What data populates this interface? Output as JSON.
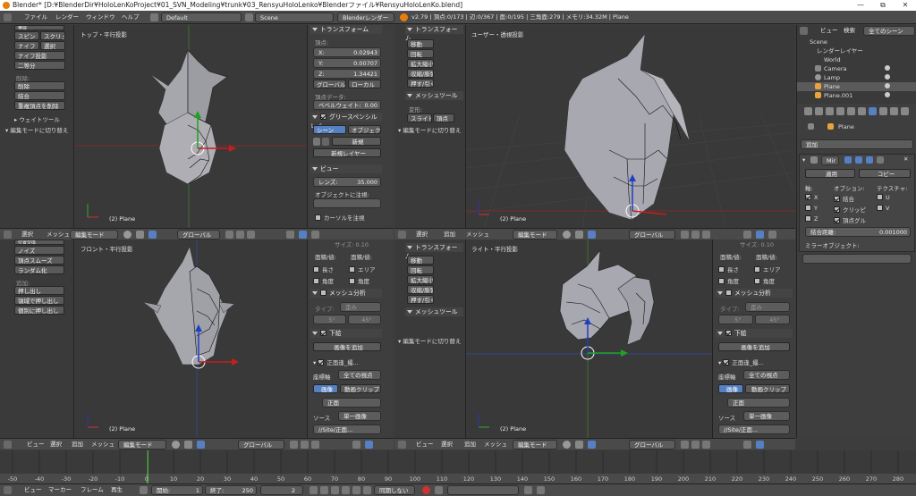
{
  "window": {
    "title": "Blender* [D:¥BlenderDir¥HoloLenKoProject¥01_SVN_Modeling¥trunk¥03_RensyuHoloLenko¥Blenderファイル¥RensyuHoloLenKo.blend]",
    "minimize": "—",
    "maximize": "⧉",
    "close": "✕"
  },
  "infobar": {
    "menu": [
      "ファイル",
      "レンダー",
      "ウィンドウ",
      "ヘルプ"
    ],
    "layout": "Default",
    "scene": "Scene",
    "engine": "Blenderレンダー",
    "stats": "v2.79 | 頂点:0/173 | 辺:0/367 | 面:0/195 | 三角面:279 | メモリ:34.32M | Plane"
  },
  "tool_tl": {
    "header": "権威",
    "row1": [
      "スピン",
      "スクリュー"
    ],
    "row2": [
      "ナイフ",
      "選択"
    ],
    "knife_proj": "ナイフ投影",
    "bisect": "二等分",
    "remove_label": "削除:",
    "delete": "削除",
    "join": "結合",
    "remove_doubles": "重複頂点を削除",
    "weight_tools": "ウェイトツール",
    "edit_mode_toggle": "編集モードに切り替え"
  },
  "tool_bl": {
    "buttons": [
      "位置交換",
      "ノイズ",
      "頂点スムーズ",
      "ランダム化"
    ],
    "add_label": "追加:",
    "extrude": "押し出し",
    "extrude_region": "領域で押し出し",
    "extrude_ind": "個別に押し出し"
  },
  "viewports": {
    "top_label": "トップ・平行投影",
    "user_label": "ユーザー・透視投影",
    "front_label": "フロント・平行投影",
    "right_label": "ライト・平行投影",
    "object": "(2) Plane"
  },
  "header": {
    "view": "ビュー",
    "select": "選択",
    "add": "追加",
    "mesh": "メッシュ",
    "mode": "編集モード",
    "orientation": "グローバル"
  },
  "npanel_tl": {
    "transform": "トランスフォーム",
    "vertex": "頂点:",
    "x": "X:",
    "xv": "0.02943",
    "y": "Y:",
    "yv": "0.00707",
    "z": "Z:",
    "zv": "1.34421",
    "global": "グローバル",
    "local": "ローカル",
    "vertex_data": "頂点データ:",
    "bevel_weight": "ベベルウェイト:",
    "bevel_value": "0.00",
    "gp_layers": "グリースペンシルレイ",
    "scene": "シーン",
    "object_btn": "オブジェクト",
    "new": "新規",
    "new_layer": "新規レイヤー",
    "view": "ビュー",
    "lens": "レンズ:",
    "lens_value": "35.000",
    "lock_to_obj": "オブジェクトに注視:",
    "lock_cursor": "カーソルを注視"
  },
  "tool_tr": {
    "transform": "トランスフォーム",
    "buttons": [
      "移動",
      "回転",
      "拡大縮小",
      "収縮/膨張",
      "押す/引く"
    ],
    "mesh_tools": "メッシュツール",
    "deform": "変形:",
    "slide": "スライド",
    "vertex": "頂点",
    "edit_mode_toggle": "編集モードに切り替え"
  },
  "npanel_bl": {
    "size": "サイズ: 0.10",
    "face_area_label": "面積/値:",
    "edge_length": "長さ",
    "area": "エリア",
    "angle": "角度",
    "face_angle": "角度",
    "mesh_analysis": "メッシュ分析",
    "type": "タイプ:",
    "type_value": "歪み",
    "min": "5°",
    "max": "45°",
    "background": "下絵",
    "add_image": "画像を追加",
    "bg_name": "正面逢_撮...",
    "axis_label": "座標軸",
    "axis_value": "全ての視点",
    "image": "画像",
    "movie_clip": "動画クリップ",
    "front_file": "正面",
    "source": "ソース",
    "source_value": "単一画像",
    "path": "//Site/正面..."
  },
  "tool_br": {
    "buttons": [
      "移動",
      "回転",
      "拡大縮小",
      "収縮/膨張",
      "押す/引く"
    ],
    "mesh_tools": "メッシュツール",
    "edit_mode_toggle": "編集モードに切り替え"
  },
  "outliner": {
    "menu": [
      "ビュー",
      "検索"
    ],
    "filter": "全てのシーン",
    "rows": [
      "Scene",
      "レンダーレイヤー",
      "World",
      "Camera",
      "Lamp",
      "Plane",
      "Plane.001"
    ]
  },
  "props": {
    "object": "Plane",
    "add_modifier": "追加",
    "modifier": "Mir",
    "apply": "適用",
    "copy": "コピー",
    "axis": "軸:",
    "options": "オプション:",
    "texture": "テクスチャ:",
    "x": "X",
    "y": "Y",
    "z": "Z",
    "merge": "結合",
    "clipping": "クリッピ",
    "vgroup": "頂点グル",
    "u": "U",
    "v": "V",
    "merge_dist": "結合距離:",
    "merge_value": "0.001000",
    "mirror_obj": "ミラーオブジェクト:"
  },
  "timeline": {
    "ticks": [
      "-50",
      "-40",
      "-30",
      "-20",
      "-10",
      "0",
      "10",
      "20",
      "30",
      "40",
      "50",
      "60",
      "70",
      "80",
      "90",
      "100",
      "110",
      "120",
      "130",
      "140",
      "150",
      "160",
      "170",
      "180",
      "190",
      "200",
      "210",
      "220",
      "230",
      "240",
      "250",
      "260",
      "270",
      "280"
    ],
    "menu": [
      "ビュー",
      "マーカー",
      "フレーム",
      "再生"
    ],
    "start": "開始:",
    "start_value": "1",
    "end": "終了:",
    "end_value": "250",
    "current": "2",
    "sync": "同期しない"
  }
}
